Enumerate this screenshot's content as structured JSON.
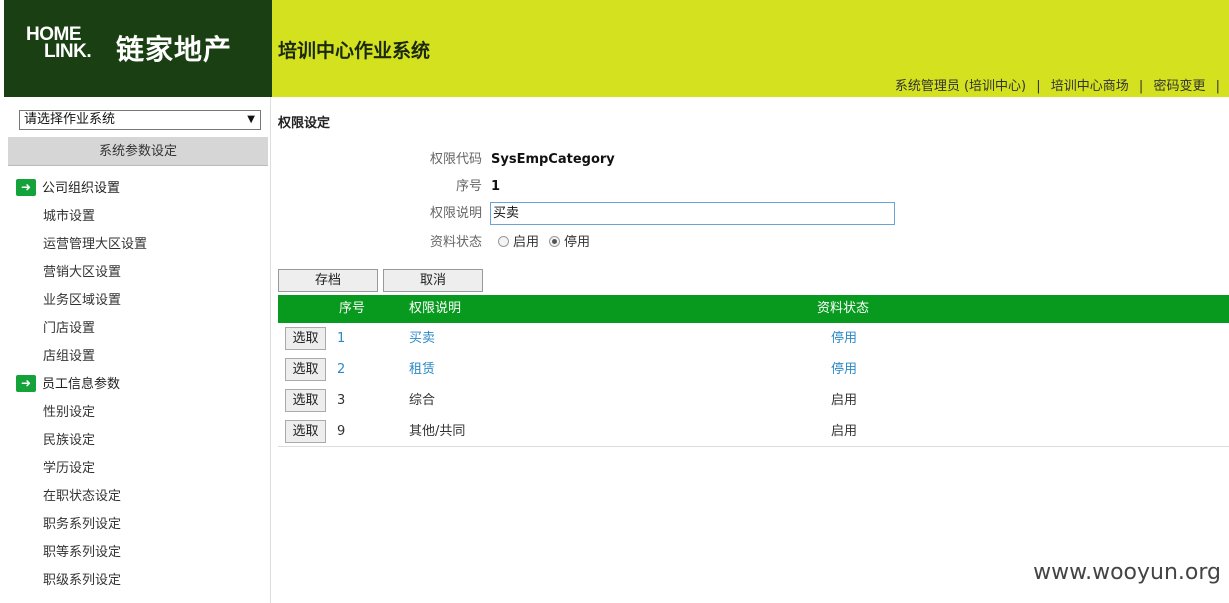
{
  "header": {
    "logo_top": "HOME",
    "logo_bottom": "LINK.",
    "logo_cn": "链家地产",
    "app_title": "培训中心作业系统",
    "links": [
      "系统管理员 (培训中心)",
      "培训中心商场",
      "密码变更"
    ],
    "separator": "|"
  },
  "sidebar": {
    "system_select": "请选择作业系统",
    "param_header": "系统参数设定",
    "groups": [
      {
        "label": "公司组织设置",
        "items": [
          "城市设置",
          "运营管理大区设置",
          "营销大区设置",
          "业务区域设置",
          "门店设置",
          "店组设置"
        ]
      },
      {
        "label": "员工信息参数",
        "items": [
          "性别设定",
          "民族设定",
          "学历设定",
          "在职状态设定",
          "职务系列设定",
          "职等系列设定",
          "职级系列设定"
        ]
      }
    ]
  },
  "main": {
    "section_title": "权限设定",
    "form": {
      "code_label": "权限代码",
      "code_value": "SysEmpCategory",
      "seq_label": "序号",
      "seq_value": "1",
      "desc_label": "权限说明",
      "desc_value": "买卖",
      "status_label": "资料状态",
      "status_on": "启用",
      "status_off": "停用",
      "status_selected": "停用"
    },
    "buttons": {
      "save": "存档",
      "cancel": "取消"
    },
    "grid": {
      "headers": [
        "序号",
        "权限说明",
        "资料状态"
      ],
      "pick_label": "选取",
      "rows": [
        {
          "no": "1",
          "desc": "买卖",
          "status": "停用",
          "link": true
        },
        {
          "no": "2",
          "desc": "租赁",
          "status": "停用",
          "link": true
        },
        {
          "no": "3",
          "desc": "综合",
          "status": "启用",
          "link": false
        },
        {
          "no": "9",
          "desc": "其他/共同",
          "status": "启用",
          "link": false
        }
      ]
    }
  },
  "watermark": "www.wooyun.org",
  "colors": {
    "brand_dark": "#1a3f12",
    "topbar": "#d4e11e",
    "grid_head": "#079a1e",
    "link": "#2b8ac6"
  }
}
